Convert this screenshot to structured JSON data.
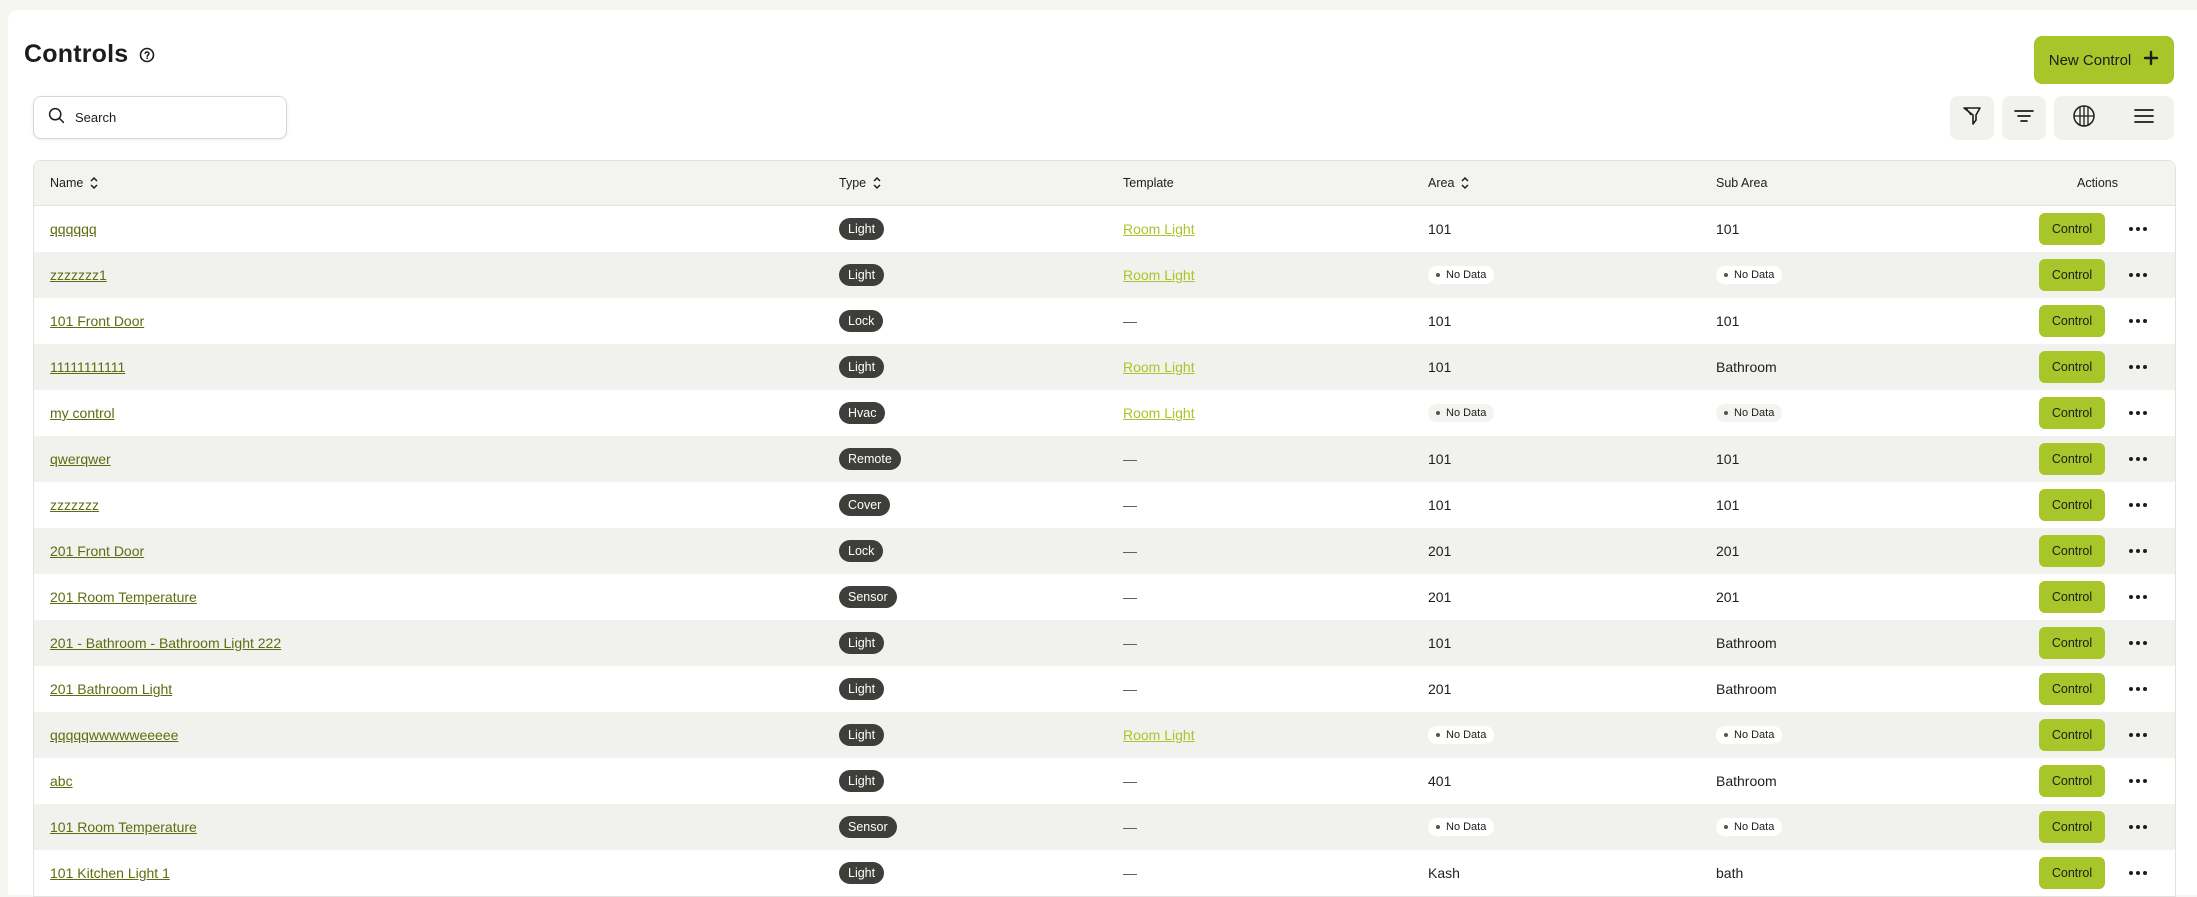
{
  "header": {
    "title": "Controls",
    "new_button_label": "New Control"
  },
  "search": {
    "placeholder": "Search"
  },
  "toolbar": {
    "icons": [
      "funnel-icon",
      "filter-lines-icon",
      "grid-view-icon",
      "list-view-icon"
    ]
  },
  "colors": {
    "accent": "#a8c629",
    "badge": "#3e3e3b",
    "link": "#5b6e0f"
  },
  "table": {
    "columns": {
      "name": "Name",
      "type": "Type",
      "template": "Template",
      "area": "Area",
      "sub_area": "Sub Area",
      "actions": "Actions"
    },
    "action_label": "Control",
    "no_data_label": "No Data",
    "rows": [
      {
        "name": "qqqqqq",
        "type": "Light",
        "template": "Room Light",
        "area": "101",
        "sub_area": "101"
      },
      {
        "name": "zzzzzzz1",
        "type": "Light",
        "template": "Room Light",
        "area": "No Data",
        "sub_area": "No Data"
      },
      {
        "name": "101 Front Door",
        "type": "Lock",
        "template": "—",
        "area": "101",
        "sub_area": "101"
      },
      {
        "name": "11111111111",
        "type": "Light",
        "template": "Room Light",
        "area": "101",
        "sub_area": "Bathroom"
      },
      {
        "name": "my control",
        "type": "Hvac",
        "template": "Room Light",
        "area": "No Data",
        "sub_area": "No Data"
      },
      {
        "name": "qwerqwer",
        "type": "Remote",
        "template": "—",
        "area": "101",
        "sub_area": "101"
      },
      {
        "name": "zzzzzzz",
        "type": "Cover",
        "template": "—",
        "area": "101",
        "sub_area": "101"
      },
      {
        "name": "201 Front Door",
        "type": "Lock",
        "template": "—",
        "area": "201",
        "sub_area": "201"
      },
      {
        "name": "201 Room Temperature",
        "type": "Sensor",
        "template": "—",
        "area": "201",
        "sub_area": "201"
      },
      {
        "name": "201 - Bathroom - Bathroom Light 222",
        "type": "Light",
        "template": "—",
        "area": "101",
        "sub_area": "Bathroom"
      },
      {
        "name": "201 Bathroom Light",
        "type": "Light",
        "template": "—",
        "area": "201",
        "sub_area": "Bathroom"
      },
      {
        "name": "qqqqqwwwwweeeee",
        "type": "Light",
        "template": "Room Light",
        "area": "No Data",
        "sub_area": "No Data"
      },
      {
        "name": "abc",
        "type": "Light",
        "template": "—",
        "area": "401",
        "sub_area": "Bathroom"
      },
      {
        "name": "101 Room Temperature",
        "type": "Sensor",
        "template": "—",
        "area": "No Data",
        "sub_area": "No Data"
      },
      {
        "name": "101 Kitchen Light 1",
        "type": "Light",
        "template": "—",
        "area": "Kash",
        "sub_area": "bath"
      }
    ]
  }
}
